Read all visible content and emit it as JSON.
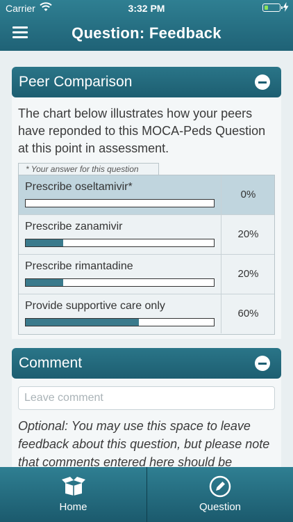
{
  "status": {
    "carrier": "Carrier",
    "time": "3:32 PM",
    "battery_level": 0.25,
    "battery_color": "#8be35a"
  },
  "header": {
    "title": "Question: Feedback",
    "menu_icon": "hamburger-menu-icon"
  },
  "peer": {
    "title": "Peer Comparison",
    "intro": "The chart below illustrates how your peers have reponded to this MOCA-Peds Question at this point in assessment.",
    "note": "* Your answer for this question",
    "answers": [
      {
        "label": "Prescribe oseltamivir*",
        "percent_text": "0%",
        "value": 0,
        "selected": true
      },
      {
        "label": "Prescribe zanamivir",
        "percent_text": "20%",
        "value": 20,
        "selected": false
      },
      {
        "label": "Prescribe rimantadine",
        "percent_text": "20%",
        "value": 20,
        "selected": false
      },
      {
        "label": "Provide supportive care only",
        "percent_text": "60%",
        "value": 60,
        "selected": false
      }
    ]
  },
  "comment": {
    "title": "Comment",
    "placeholder": "Leave comment",
    "value": "",
    "help": "Optional: You may use this space to leave feedback about this question, but please note that comments entered here should be"
  },
  "tabs": [
    {
      "label": "Home",
      "icon": "box-icon"
    },
    {
      "label": "Question",
      "icon": "pencil-circle-icon"
    }
  ],
  "colors": {
    "primary": "#1d5e71",
    "bar_fill": "#3a7a8c",
    "selected_row": "#c0d5de"
  }
}
